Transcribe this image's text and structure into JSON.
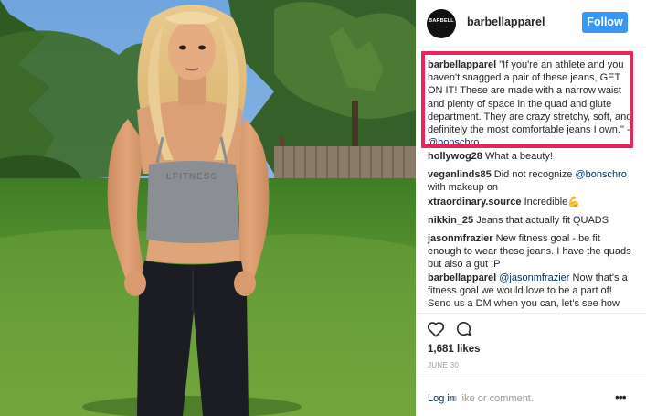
{
  "post": {
    "username": "barbellapparel",
    "follow_label": "Follow",
    "avatar_text": "BARBELL",
    "caption": {
      "username": "barbellapparel",
      "text": " \"If you're an athlete and you haven't snagged a pair of these jeans, GET ON IT! These are made with a narrow waist and plenty of space in the quad and glute department. They are crazy stretchy, soft, and definitely the most comfortable jeans I own.\" - ",
      "mention": "@bonschro"
    },
    "comments": [
      {
        "username": "hollywog28",
        "text": " What a beauty!"
      },
      {
        "username": "veganlinds85",
        "text": " Did not recognize ",
        "mention": "@bonschro",
        "text2": " with makeup on"
      },
      {
        "username": "xtraordinary.source",
        "text": " Incredible",
        "emoji": "💪"
      },
      {
        "username": "nikkin_25",
        "text": " Jeans that actually fit QUADS"
      },
      {
        "username": "jasonmfrazier",
        "text": " New fitness goal - be fit enough to wear these jeans. I have the quads but also a gut :P"
      },
      {
        "username": "barbellapparel",
        "mention": "@jasonmfrazier",
        "text": " Now that's a fitness goal we would love to be a part of! Send us a DM when you can, let's see how"
      }
    ],
    "likes": "1,681 likes",
    "date": "JUNE 30",
    "login_link": "Log in",
    "login_text": " to like or comment.",
    "more_label": "•••",
    "shirt_text": "LFITNESS"
  },
  "icons": [
    "heart-icon",
    "comment-icon",
    "more-options-icon"
  ],
  "colors": {
    "follow_button": "#3897f0",
    "highlight_border": "#e8245a",
    "link": "#003569"
  }
}
